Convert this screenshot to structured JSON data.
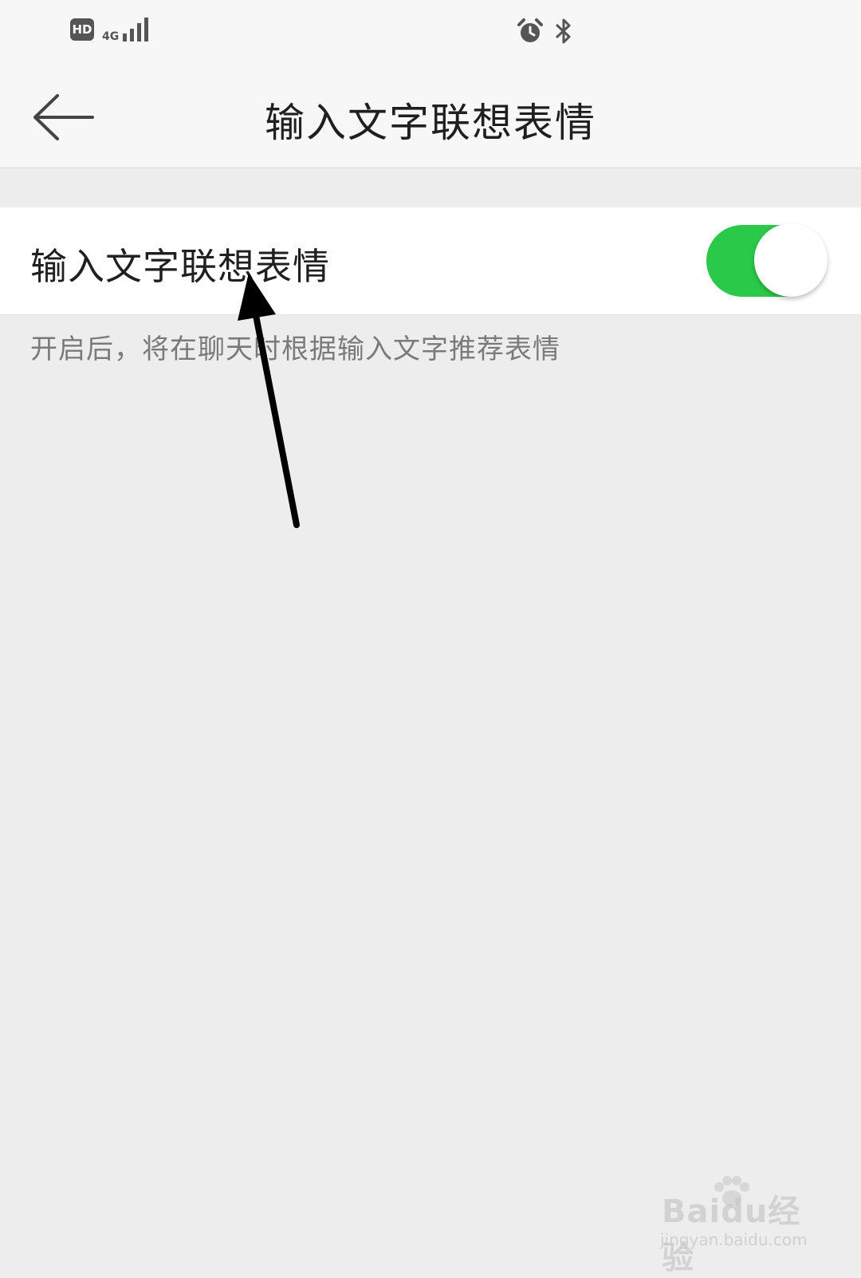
{
  "status_bar": {
    "hd_label": "HD",
    "network_type": "4G",
    "icons": [
      "signal-icon",
      "alarm-icon",
      "bluetooth-icon"
    ]
  },
  "header": {
    "title": "输入文字联想表情",
    "back_icon": "back-arrow-icon"
  },
  "setting": {
    "label": "输入文字联想表情",
    "enabled": true,
    "description": "开启后，将在聊天时根据输入文字推荐表情"
  },
  "colors": {
    "toggle_on": "#2bc94a",
    "page_background": "#ededed",
    "header_background": "#f7f7f7"
  },
  "watermark": {
    "logo_text": "Baidu经验",
    "url": "jingyan.baidu.com"
  }
}
